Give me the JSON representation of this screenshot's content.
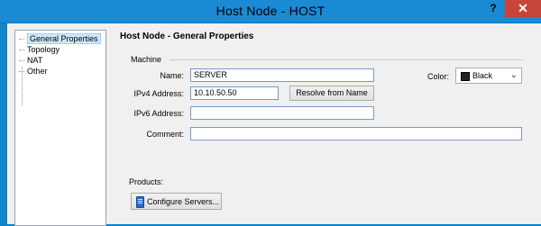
{
  "window": {
    "title": "Host Node - HOST",
    "help_label": "?",
    "close_label": "✕"
  },
  "tree": {
    "items": [
      {
        "label": "General Properties",
        "selected": true
      },
      {
        "label": "Topology",
        "selected": false
      },
      {
        "label": "NAT",
        "selected": false
      },
      {
        "label": "Other",
        "selected": false
      }
    ]
  },
  "panel": {
    "title": "Host Node - General Properties",
    "machine_group": "Machine",
    "name_label": "Name:",
    "name_value": "SERVER",
    "ipv4_label": "IPv4 Address:",
    "ipv4_value": "10.10.50.50",
    "resolve_button": "Resolve from Name",
    "ipv6_label": "IPv6 Address:",
    "ipv6_value": "",
    "comment_label": "Comment:",
    "comment_value": "",
    "color_label": "Color:",
    "color_value": "Black",
    "color_swatch": "#222222",
    "products_label": "Products:",
    "configure_button": "Configure Servers..."
  },
  "colors": {
    "titlebar": "#1a8ad4",
    "close": "#c7453a",
    "client": "#f0f0f0"
  }
}
